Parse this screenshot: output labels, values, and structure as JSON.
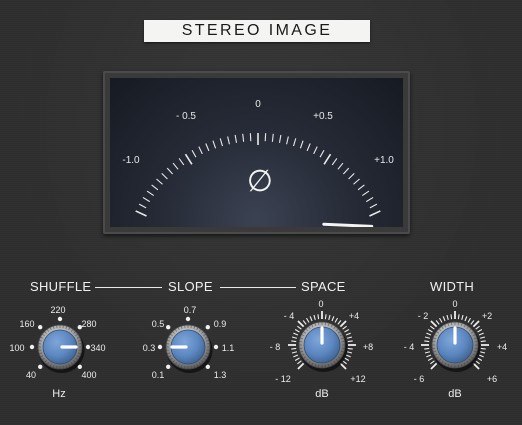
{
  "title": "STEREO IMAGE",
  "meter": {
    "scale_labels": [
      "-1.0",
      "- 0.5",
      "0",
      "+0.5",
      "+1.0"
    ],
    "phase_symbol": "∅",
    "needle_value": 0.93
  },
  "controls": {
    "shuffle": {
      "label": "SHUFFLE",
      "unit": "Hz",
      "scale": [
        "40",
        "100",
        "160",
        "220",
        "280",
        "340",
        "400"
      ],
      "value": 340
    },
    "slope": {
      "label": "SLOPE",
      "scale": [
        "0.1",
        "0.3",
        "0.5",
        "0.7",
        "0.9",
        "1.1",
        "1.3"
      ],
      "value": 0.3
    },
    "space": {
      "label": "SPACE",
      "unit": "dB",
      "scale": [
        "- 12",
        "- 8",
        "- 4",
        "0",
        "+4",
        "+8",
        "+12"
      ],
      "value": 0
    },
    "width": {
      "label": "WIDTH",
      "unit": "dB",
      "scale": [
        "- 6",
        "- 4",
        "- 2",
        "0",
        "+2",
        "+4",
        "+6"
      ],
      "value": 0
    }
  },
  "colors": {
    "knob_cap": "#5b86bf",
    "panel": "#2e2e2e",
    "meter_face": "#262b37"
  }
}
